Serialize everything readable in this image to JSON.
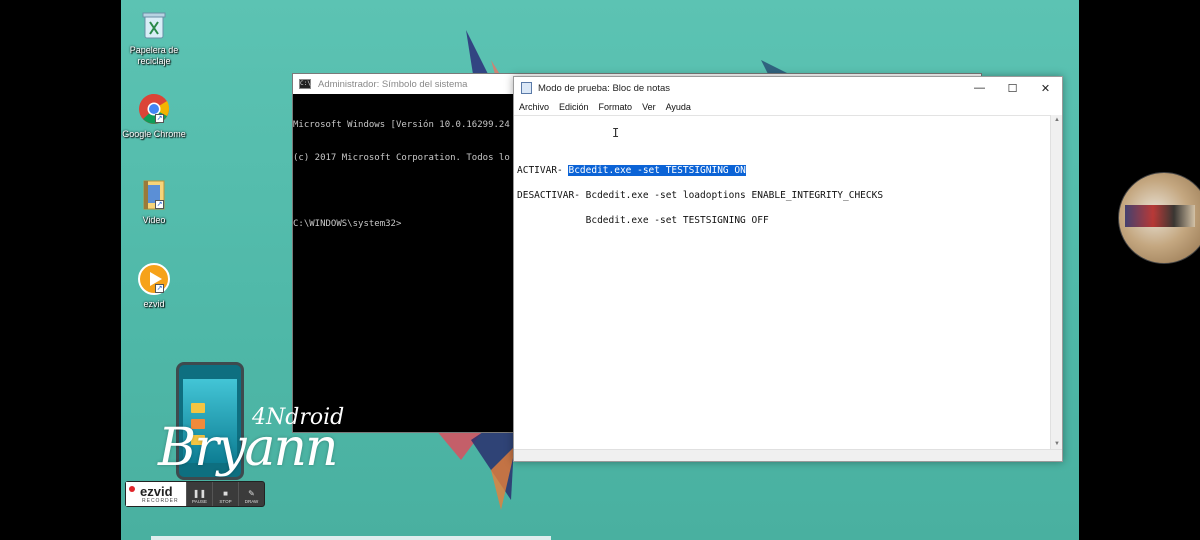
{
  "desktop_icons": [
    {
      "label": "Papelera de reciclaje",
      "icon": "recycle-bin-icon"
    },
    {
      "label": "Google Chrome",
      "icon": "chrome-icon"
    },
    {
      "label": "Video",
      "icon": "video-folder-icon"
    },
    {
      "label": "ezvid",
      "icon": "ezvid-icon"
    }
  ],
  "cmd": {
    "title": "Administrador: Símbolo del sistema",
    "lines": [
      "Microsoft Windows [Versión 10.0.16299.24",
      "(c) 2017 Microsoft Corporation. Todos lo",
      "",
      "C:\\WINDOWS\\system32>"
    ]
  },
  "notepad": {
    "title": "Modo de prueba: Bloc de notas",
    "menu": [
      "Archivo",
      "Edición",
      "Formato",
      "Ver",
      "Ayuda"
    ],
    "controls": {
      "minimize": "—",
      "maximize": "☐",
      "close": "✕"
    },
    "lines": {
      "activar_prefix": "ACTIVAR- ",
      "activar_selected": "Bcdedit.exe -set TESTSIGNING ON",
      "desactivar_1": "DESACTIVAR- Bcdedit.exe -set loadoptions ENABLE_INTEGRITY_CHECKS",
      "desactivar_2": "            Bcdedit.exe -set TESTSIGNING OFF"
    }
  },
  "overlay": {
    "brand": "Bryann",
    "brand_sub": "4Ndroid"
  },
  "ezvid": {
    "name": "ezvid",
    "sub": "RECORDER",
    "buttons": [
      {
        "glyph": "❚❚",
        "label": "PAUSE"
      },
      {
        "glyph": "■",
        "label": "STOP"
      },
      {
        "glyph": "✎",
        "label": "DRAW"
      }
    ]
  },
  "colors": {
    "desktop": "#5cc3b3",
    "selection": "#0b63d6",
    "ezvid_red": "#e0242a"
  }
}
